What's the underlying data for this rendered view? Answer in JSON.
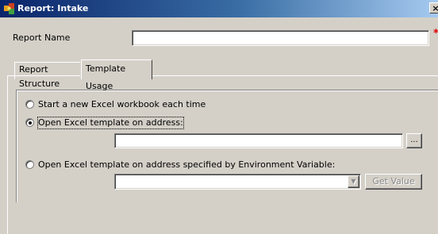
{
  "window": {
    "title": "Report: Intake",
    "close_glyph": "×",
    "icon": "app-puzzle-icon"
  },
  "form": {
    "report_name_label": "Report Name",
    "report_name_value": "",
    "required_marker": "*"
  },
  "tabs": [
    {
      "label": "Report Structure",
      "active": false
    },
    {
      "label": "Template Usage",
      "active": true
    }
  ],
  "template_usage": {
    "options": [
      {
        "label": "Start a new Excel workbook each time",
        "selected": false
      },
      {
        "label": "Open Excel template on address:",
        "selected": true
      },
      {
        "label": "Open Excel template on address specified by Environment Variable:",
        "selected": false
      }
    ],
    "address_value": "",
    "browse_label": "...",
    "env_variable_value": "",
    "dropdown_glyph": "▼",
    "get_value_label": "Get Value"
  },
  "colors": {
    "title_start": "#0a246a",
    "title_end": "#a6caf0",
    "face": "#d4d0c8",
    "required": "#e00000"
  }
}
